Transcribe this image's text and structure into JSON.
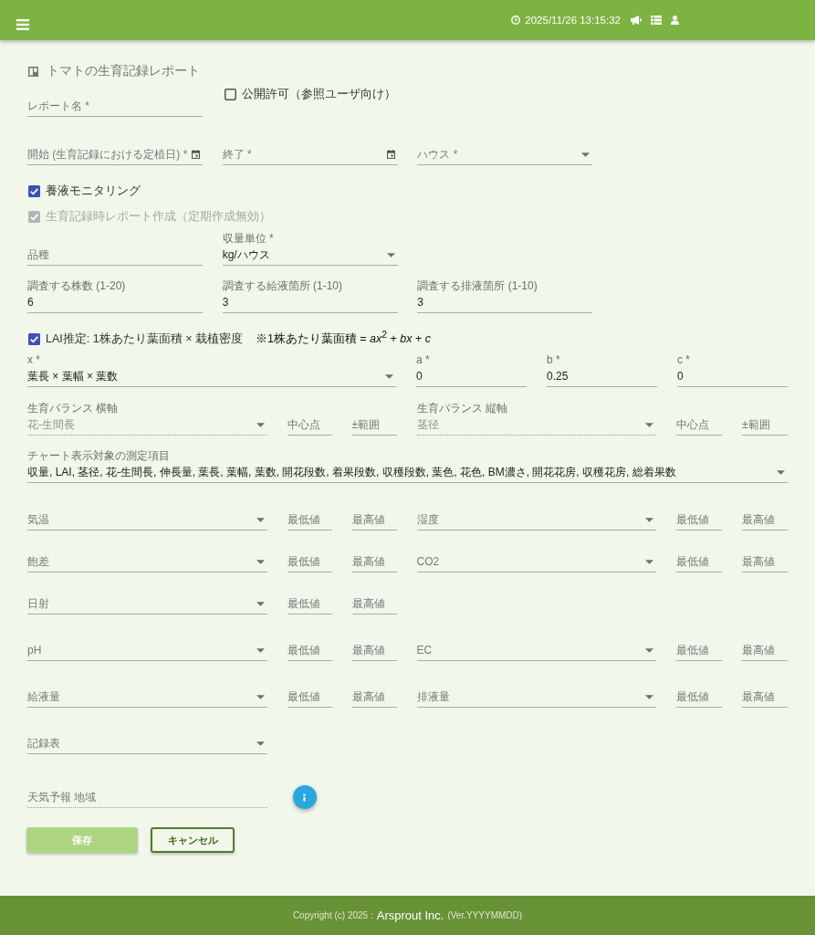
{
  "top_bar": {
    "datetime": "2025/11/26 13:15:32"
  },
  "title": "トマトの生育記録レポート",
  "report_name": {
    "placeholder": "レポート名 *"
  },
  "public": {
    "label": "公開許可（参照ユーザ向け）",
    "checked": false
  },
  "period": {
    "start": {
      "placeholder": "開始 (生育記録における定植日) *"
    },
    "end": {
      "placeholder": "終了 *"
    },
    "house": {
      "placeholder": "ハウス *"
    }
  },
  "options": [
    {
      "label": "養液モニタリング",
      "checked": true,
      "disabled": false
    },
    {
      "label": "生育記録時レポート作成（定期作成無効）",
      "checked": true,
      "disabled": true
    }
  ],
  "variety": {
    "placeholder": "品種"
  },
  "yield_unit": {
    "label": "収量単位 *",
    "value": "kg/ハウス"
  },
  "survey": [
    {
      "label": "調査する株数 (1-20)",
      "value": "6"
    },
    {
      "label": "調査する給液箇所 (1-10)",
      "value": "3"
    },
    {
      "label": "調査する排液箇所 (1-10)",
      "value": "3"
    }
  ],
  "lai": {
    "label": "LAI推定: 1株あたり葉面積 × 栽植密度",
    "checked": true,
    "formula": "※1株あたり葉面積 = *ax*$^{2}$ + *bx* + *c*"
  },
  "lai_x": {
    "label": "x *",
    "value": "葉長 × 葉幅 × 葉数"
  },
  "coefficients": [
    {
      "label": "a *",
      "value": "0"
    },
    {
      "label": "b *",
      "value": "0.25"
    },
    {
      "label": "c *",
      "value": "0"
    }
  ],
  "growth_balance": [
    {
      "label": "生育バランス 横軸",
      "value": "花-生間長",
      "disabled": true,
      "center": {
        "placeholder": "中心点"
      },
      "range": {
        "placeholder": "±範囲"
      }
    },
    {
      "label": "生育バランス 縦軸",
      "value": "茎径",
      "disabled": true,
      "center": {
        "placeholder": "中心点"
      },
      "range": {
        "placeholder": "±範囲"
      }
    }
  ],
  "chart_items": {
    "label": "チャート表示対象の測定項目",
    "value": "収量, LAI, 茎径, 花-生間長, 伸長量, 葉長, 葉幅, 葉数, 開花段数, 着果段数, 収穫段数, 葉色, 花色, BM濃さ, 開花花房, 収穫花房, 総着果数"
  },
  "environment": [
    {
      "sensors": [
        {
          "placeholder": "気温",
          "min": {
            "placeholder": "最低値"
          },
          "max": {
            "placeholder": "最高値"
          }
        },
        {
          "placeholder": "湿度",
          "min": {
            "placeholder": "最低値"
          },
          "max": {
            "placeholder": "最高値"
          }
        }
      ]
    },
    {
      "sensors": [
        {
          "placeholder": "飽差",
          "min": {
            "placeholder": "最低値"
          },
          "max": {
            "placeholder": "最高値"
          }
        },
        {
          "placeholder": "CO2",
          "min": {
            "placeholder": "最低値"
          },
          "max": {
            "placeholder": "最高値"
          }
        }
      ]
    },
    {
      "sensors": [
        {
          "placeholder": "日射",
          "min": {
            "placeholder": "最低値"
          },
          "max": {
            "placeholder": "最高値"
          }
        }
      ]
    },
    {
      "sensors": [
        {
          "placeholder": "pH",
          "min": {
            "placeholder": "最低値"
          },
          "max": {
            "placeholder": "最高値"
          }
        },
        {
          "placeholder": "EC",
          "min": {
            "placeholder": "最低値"
          },
          "max": {
            "placeholder": "最高値"
          }
        }
      ]
    },
    {
      "sensors": [
        {
          "placeholder": "給液量",
          "min": {
            "placeholder": "最低値"
          },
          "max": {
            "placeholder": "最高値"
          }
        },
        {
          "placeholder": "排液量",
          "min": {
            "placeholder": "最低値"
          },
          "max": {
            "placeholder": "最高値"
          }
        }
      ]
    }
  ],
  "record_table": {
    "placeholder": "記録表"
  },
  "weather_region": {
    "placeholder": "天気予報 地域",
    "disabled": true
  },
  "buttons": [
    {
      "label": "保存",
      "kind": "primary",
      "disabled": true
    },
    {
      "label": "キャンセル",
      "kind": "secondary",
      "disabled": false
    }
  ],
  "footer": {
    "copyright": "Copyright (c) 2025 :",
    "company": "Arsprout Inc.",
    "version": "(Ver.YYYYMMDD)"
  }
}
